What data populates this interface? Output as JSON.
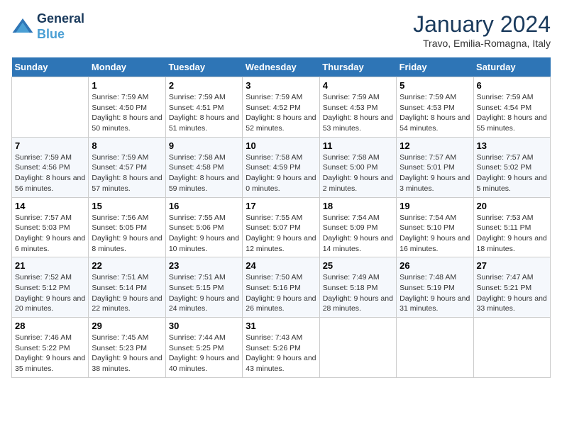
{
  "header": {
    "logo_line1": "General",
    "logo_line2": "Blue",
    "month_title": "January 2024",
    "location": "Travo, Emilia-Romagna, Italy"
  },
  "weekdays": [
    "Sunday",
    "Monday",
    "Tuesday",
    "Wednesday",
    "Thursday",
    "Friday",
    "Saturday"
  ],
  "weeks": [
    [
      {
        "day": "",
        "sunrise": "",
        "sunset": "",
        "daylight": ""
      },
      {
        "day": "1",
        "sunrise": "Sunrise: 7:59 AM",
        "sunset": "Sunset: 4:50 PM",
        "daylight": "Daylight: 8 hours and 50 minutes."
      },
      {
        "day": "2",
        "sunrise": "Sunrise: 7:59 AM",
        "sunset": "Sunset: 4:51 PM",
        "daylight": "Daylight: 8 hours and 51 minutes."
      },
      {
        "day": "3",
        "sunrise": "Sunrise: 7:59 AM",
        "sunset": "Sunset: 4:52 PM",
        "daylight": "Daylight: 8 hours and 52 minutes."
      },
      {
        "day": "4",
        "sunrise": "Sunrise: 7:59 AM",
        "sunset": "Sunset: 4:53 PM",
        "daylight": "Daylight: 8 hours and 53 minutes."
      },
      {
        "day": "5",
        "sunrise": "Sunrise: 7:59 AM",
        "sunset": "Sunset: 4:53 PM",
        "daylight": "Daylight: 8 hours and 54 minutes."
      },
      {
        "day": "6",
        "sunrise": "Sunrise: 7:59 AM",
        "sunset": "Sunset: 4:54 PM",
        "daylight": "Daylight: 8 hours and 55 minutes."
      }
    ],
    [
      {
        "day": "7",
        "sunrise": "Sunrise: 7:59 AM",
        "sunset": "Sunset: 4:56 PM",
        "daylight": "Daylight: 8 hours and 56 minutes."
      },
      {
        "day": "8",
        "sunrise": "Sunrise: 7:59 AM",
        "sunset": "Sunset: 4:57 PM",
        "daylight": "Daylight: 8 hours and 57 minutes."
      },
      {
        "day": "9",
        "sunrise": "Sunrise: 7:58 AM",
        "sunset": "Sunset: 4:58 PM",
        "daylight": "Daylight: 8 hours and 59 minutes."
      },
      {
        "day": "10",
        "sunrise": "Sunrise: 7:58 AM",
        "sunset": "Sunset: 4:59 PM",
        "daylight": "Daylight: 9 hours and 0 minutes."
      },
      {
        "day": "11",
        "sunrise": "Sunrise: 7:58 AM",
        "sunset": "Sunset: 5:00 PM",
        "daylight": "Daylight: 9 hours and 2 minutes."
      },
      {
        "day": "12",
        "sunrise": "Sunrise: 7:57 AM",
        "sunset": "Sunset: 5:01 PM",
        "daylight": "Daylight: 9 hours and 3 minutes."
      },
      {
        "day": "13",
        "sunrise": "Sunrise: 7:57 AM",
        "sunset": "Sunset: 5:02 PM",
        "daylight": "Daylight: 9 hours and 5 minutes."
      }
    ],
    [
      {
        "day": "14",
        "sunrise": "Sunrise: 7:57 AM",
        "sunset": "Sunset: 5:03 PM",
        "daylight": "Daylight: 9 hours and 6 minutes."
      },
      {
        "day": "15",
        "sunrise": "Sunrise: 7:56 AM",
        "sunset": "Sunset: 5:05 PM",
        "daylight": "Daylight: 9 hours and 8 minutes."
      },
      {
        "day": "16",
        "sunrise": "Sunrise: 7:55 AM",
        "sunset": "Sunset: 5:06 PM",
        "daylight": "Daylight: 9 hours and 10 minutes."
      },
      {
        "day": "17",
        "sunrise": "Sunrise: 7:55 AM",
        "sunset": "Sunset: 5:07 PM",
        "daylight": "Daylight: 9 hours and 12 minutes."
      },
      {
        "day": "18",
        "sunrise": "Sunrise: 7:54 AM",
        "sunset": "Sunset: 5:09 PM",
        "daylight": "Daylight: 9 hours and 14 minutes."
      },
      {
        "day": "19",
        "sunrise": "Sunrise: 7:54 AM",
        "sunset": "Sunset: 5:10 PM",
        "daylight": "Daylight: 9 hours and 16 minutes."
      },
      {
        "day": "20",
        "sunrise": "Sunrise: 7:53 AM",
        "sunset": "Sunset: 5:11 PM",
        "daylight": "Daylight: 9 hours and 18 minutes."
      }
    ],
    [
      {
        "day": "21",
        "sunrise": "Sunrise: 7:52 AM",
        "sunset": "Sunset: 5:12 PM",
        "daylight": "Daylight: 9 hours and 20 minutes."
      },
      {
        "day": "22",
        "sunrise": "Sunrise: 7:51 AM",
        "sunset": "Sunset: 5:14 PM",
        "daylight": "Daylight: 9 hours and 22 minutes."
      },
      {
        "day": "23",
        "sunrise": "Sunrise: 7:51 AM",
        "sunset": "Sunset: 5:15 PM",
        "daylight": "Daylight: 9 hours and 24 minutes."
      },
      {
        "day": "24",
        "sunrise": "Sunrise: 7:50 AM",
        "sunset": "Sunset: 5:16 PM",
        "daylight": "Daylight: 9 hours and 26 minutes."
      },
      {
        "day": "25",
        "sunrise": "Sunrise: 7:49 AM",
        "sunset": "Sunset: 5:18 PM",
        "daylight": "Daylight: 9 hours and 28 minutes."
      },
      {
        "day": "26",
        "sunrise": "Sunrise: 7:48 AM",
        "sunset": "Sunset: 5:19 PM",
        "daylight": "Daylight: 9 hours and 31 minutes."
      },
      {
        "day": "27",
        "sunrise": "Sunrise: 7:47 AM",
        "sunset": "Sunset: 5:21 PM",
        "daylight": "Daylight: 9 hours and 33 minutes."
      }
    ],
    [
      {
        "day": "28",
        "sunrise": "Sunrise: 7:46 AM",
        "sunset": "Sunset: 5:22 PM",
        "daylight": "Daylight: 9 hours and 35 minutes."
      },
      {
        "day": "29",
        "sunrise": "Sunrise: 7:45 AM",
        "sunset": "Sunset: 5:23 PM",
        "daylight": "Daylight: 9 hours and 38 minutes."
      },
      {
        "day": "30",
        "sunrise": "Sunrise: 7:44 AM",
        "sunset": "Sunset: 5:25 PM",
        "daylight": "Daylight: 9 hours and 40 minutes."
      },
      {
        "day": "31",
        "sunrise": "Sunrise: 7:43 AM",
        "sunset": "Sunset: 5:26 PM",
        "daylight": "Daylight: 9 hours and 43 minutes."
      },
      {
        "day": "",
        "sunrise": "",
        "sunset": "",
        "daylight": ""
      },
      {
        "day": "",
        "sunrise": "",
        "sunset": "",
        "daylight": ""
      },
      {
        "day": "",
        "sunrise": "",
        "sunset": "",
        "daylight": ""
      }
    ]
  ]
}
